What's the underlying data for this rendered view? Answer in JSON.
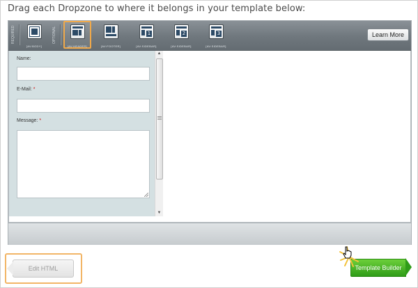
{
  "instruction": "Drag each Dropzone to where it belongs in your template below:",
  "toolbar": {
    "required_label": "REQUIRED",
    "optional_label": "OPTIONAL",
    "learn_more_label": "Learn More",
    "dropzones": [
      {
        "label": "[AV:BODY]",
        "icon": "layout-body-icon"
      },
      {
        "label": "[AV:HEADER]",
        "icon": "layout-header-icon",
        "selected": true
      },
      {
        "label": "[AV:FOOTER]",
        "icon": "layout-footer-icon"
      },
      {
        "label": "[AV:SIDEBAR]",
        "icon": "layout-sidebar-1-icon",
        "number": "1"
      },
      {
        "label": "[AV:SIDEBAR]",
        "icon": "layout-sidebar-2-icon",
        "number": "2"
      },
      {
        "label": "[AV:SIDEBAR]",
        "icon": "layout-sidebar-3-icon",
        "number": "3"
      }
    ]
  },
  "form": {
    "name_label": "Name:",
    "email_label": "E-Mail:",
    "message_label": "Message:",
    "required_marker": "*"
  },
  "buttons": {
    "edit_html": "Edit HTML",
    "template_builder": "Template Builder"
  },
  "colors": {
    "highlight": "#f0a94a",
    "template_builder_green": "#2f9c18",
    "form_bg": "#d4e0e2"
  }
}
